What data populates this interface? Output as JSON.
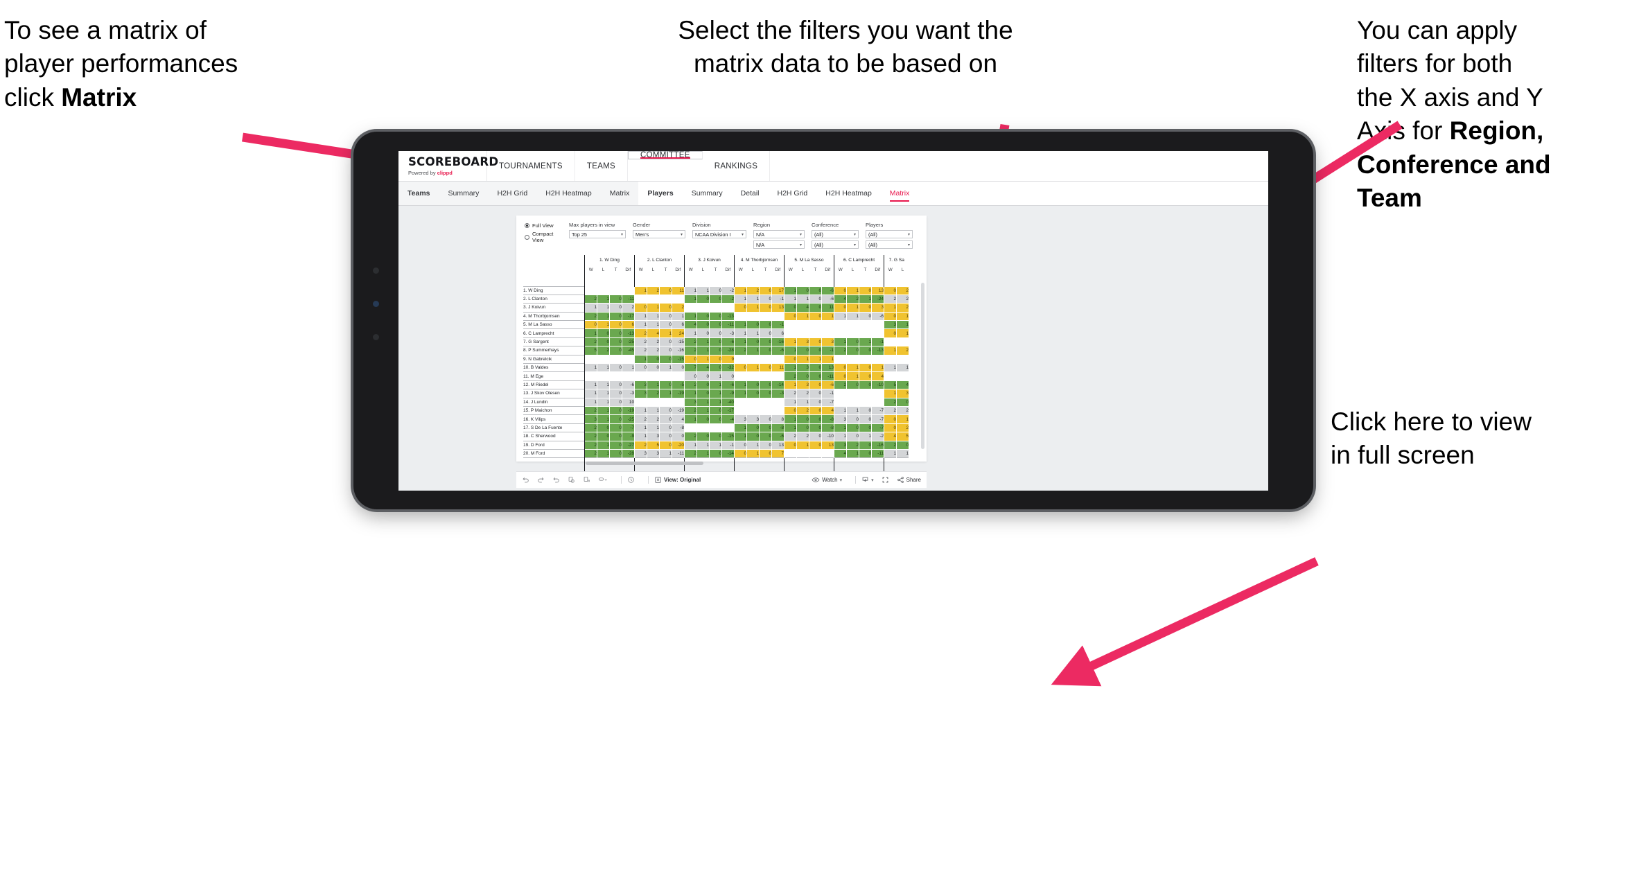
{
  "annotations": {
    "matrix_hint": {
      "pre": "To see a matrix of\nplayer performances\nclick ",
      "bold": "Matrix"
    },
    "filters_hint": "Select the filters you want the\nmatrix data to be based on",
    "axis_hint": {
      "pre": "You  can apply\nfilters for both\nthe X axis and Y\nAxis for ",
      "bold": "Region,\nConference and\nTeam"
    },
    "fullscreen_hint": "Click here to view\nin full screen"
  },
  "accent_color": "#e8174c",
  "brand": {
    "title": "SCOREBOARD",
    "powered_pre": "Powered by ",
    "powered_by": "clippd"
  },
  "main_nav": [
    {
      "label": "TOURNAMENTS",
      "selected": false
    },
    {
      "label": "TEAMS",
      "selected": false
    },
    {
      "label": "COMMITTEE",
      "selected": true
    },
    {
      "label": "RANKINGS",
      "selected": false
    }
  ],
  "sub_nav": {
    "teams_group": [
      {
        "label": "Teams",
        "head": true,
        "active": false
      },
      {
        "label": "Summary",
        "head": false,
        "active": false
      },
      {
        "label": "H2H Grid",
        "head": false,
        "active": false
      },
      {
        "label": "H2H Heatmap",
        "head": false,
        "active": false
      },
      {
        "label": "Matrix",
        "head": false,
        "active": false
      }
    ],
    "players_group": [
      {
        "label": "Players",
        "head": true,
        "active": false
      },
      {
        "label": "Summary",
        "head": false,
        "active": false
      },
      {
        "label": "Detail",
        "head": false,
        "active": false
      },
      {
        "label": "H2H Grid",
        "head": false,
        "active": false
      },
      {
        "label": "H2H Heatmap",
        "head": false,
        "active": false
      },
      {
        "label": "Matrix",
        "head": false,
        "active": true
      }
    ]
  },
  "filters": {
    "view_options": [
      {
        "label": "Full View",
        "selected": true
      },
      {
        "label": "Compact View",
        "selected": false
      }
    ],
    "max_players": {
      "label": "Max players in view",
      "value": "Top 25"
    },
    "gender": {
      "label": "Gender",
      "value": "Men's"
    },
    "division": {
      "label": "Division",
      "value": "NCAA Division I"
    },
    "region": {
      "label": "Region",
      "x_value": "N/A",
      "y_value": "N/A"
    },
    "conference": {
      "label": "Conference",
      "x_value": "(All)",
      "y_value": "(All)"
    },
    "players": {
      "label": "Players",
      "x_value": "(All)",
      "y_value": "(All)"
    }
  },
  "matrix": {
    "sub_headers": [
      "W",
      "L",
      "T",
      "Dif"
    ],
    "columns": [
      "1. W Ding",
      "2. L Clanton",
      "3. J Koivun",
      "4. M Thorbjornsen",
      "5. M La Sasso",
      "6. C Lamprecht",
      "7. G Sa"
    ],
    "rows": [
      {
        "name": "1. W Ding",
        "cells": [
          [
            "w",
            "",
            "",
            "",
            ""
          ],
          [
            "y",
            "1",
            "2",
            "0",
            "11"
          ],
          [
            "s",
            "1",
            "1",
            "0",
            "-2"
          ],
          [
            "y",
            "1",
            "2",
            "0",
            "17"
          ],
          [
            "g",
            "1",
            "0",
            "0",
            "-6"
          ],
          [
            "y",
            "0",
            "1",
            "0",
            "13"
          ],
          [
            "y",
            "0",
            "2"
          ]
        ]
      },
      {
        "name": "2. L Clanton",
        "cells": [
          [
            "g",
            "2",
            "1",
            "0",
            "-11"
          ],
          [
            "w",
            "",
            "",
            "",
            ""
          ],
          [
            "g",
            "1",
            "0",
            "0",
            "-2"
          ],
          [
            "s",
            "1",
            "1",
            "0",
            "-1"
          ],
          [
            "s",
            "1",
            "1",
            "0",
            "-6"
          ],
          [
            "g",
            "4",
            "2",
            "1",
            "-24"
          ],
          [
            "s",
            "2",
            "2"
          ]
        ]
      },
      {
        "name": "3. J Koivun",
        "cells": [
          [
            "s",
            "1",
            "1",
            "0",
            "2"
          ],
          [
            "y",
            "0",
            "1",
            "0",
            "2"
          ],
          [
            "w",
            "",
            "",
            "",
            ""
          ],
          [
            "y",
            "0",
            "1",
            "0",
            "13"
          ],
          [
            "g",
            "0",
            "4",
            "0",
            "11"
          ],
          [
            "y",
            "0",
            "1",
            "0",
            "3"
          ],
          [
            "y",
            "1",
            "2"
          ]
        ]
      },
      {
        "name": "4. M Thorbjornsen",
        "cells": [
          [
            "g",
            "2",
            "1",
            "0",
            "-17"
          ],
          [
            "s",
            "1",
            "1",
            "0",
            "1"
          ],
          [
            "g",
            "1",
            "0",
            "0",
            "-13"
          ],
          [
            "w",
            "",
            "",
            "",
            ""
          ],
          [
            "y",
            "0",
            "1",
            "0",
            "1"
          ],
          [
            "s",
            "1",
            "1",
            "0",
            "-6"
          ],
          [
            "y",
            "0",
            "1"
          ]
        ]
      },
      {
        "name": "5. M La Sasso",
        "cells": [
          [
            "y",
            "0",
            "1",
            "0",
            "6"
          ],
          [
            "s",
            "1",
            "1",
            "0",
            "6"
          ],
          [
            "g",
            "4",
            "0",
            "0",
            "-11"
          ],
          [
            "g",
            "1",
            "0",
            "0",
            "-1"
          ],
          [
            "w",
            "",
            "",
            "",
            ""
          ],
          [
            "w",
            "",
            "",
            "",
            ""
          ],
          [
            "g",
            "3",
            "1"
          ]
        ]
      },
      {
        "name": "6. C Lamprecht",
        "cells": [
          [
            "g",
            "1",
            "0",
            "0",
            "-13"
          ],
          [
            "y",
            "2",
            "4",
            "1",
            "24"
          ],
          [
            "s",
            "1",
            "0",
            "0",
            "-3"
          ],
          [
            "s",
            "1",
            "1",
            "0",
            "6"
          ],
          [
            "w",
            "",
            "",
            "",
            ""
          ],
          [
            "w",
            "",
            "",
            "",
            ""
          ],
          [
            "y",
            "0",
            "1"
          ]
        ]
      },
      {
        "name": "7. G Sargent",
        "cells": [
          [
            "g",
            "2",
            "0",
            "0",
            "-25"
          ],
          [
            "s",
            "2",
            "2",
            "0",
            "-15"
          ],
          [
            "g",
            "2",
            "1",
            "0",
            "-6"
          ],
          [
            "g",
            "1",
            "0",
            "0",
            "-16"
          ],
          [
            "y",
            "1",
            "3",
            "0",
            "3"
          ],
          [
            "g",
            "1",
            "0",
            "1",
            "-1"
          ],
          [
            "w",
            "",
            ""
          ]
        ]
      },
      {
        "name": "8. P Summerhays",
        "cells": [
          [
            "g",
            "5",
            "2",
            "0",
            "-45"
          ],
          [
            "s",
            "2",
            "2",
            "0",
            "-16"
          ],
          [
            "g",
            "2",
            "1",
            "0",
            "-28"
          ],
          [
            "g",
            "2",
            "1",
            "0",
            "-6"
          ],
          [
            "g",
            "1",
            "0",
            "0",
            "-1"
          ],
          [
            "g",
            "2",
            "0",
            "0",
            "-13"
          ],
          [
            "y",
            "1",
            "2"
          ]
        ]
      },
      {
        "name": "9. N Gabrelcik",
        "cells": [
          [
            "w",
            "",
            "",
            "",
            ""
          ],
          [
            "g",
            "1",
            "0",
            "0",
            "-15"
          ],
          [
            "y",
            "0",
            "1",
            "0",
            "9"
          ],
          [
            "w",
            "",
            "",
            "",
            ""
          ],
          [
            "y",
            "0",
            "1",
            "1",
            "1"
          ],
          [
            "w",
            "",
            "",
            "",
            ""
          ],
          [
            "w",
            "",
            ""
          ]
        ]
      },
      {
        "name": "10. B Valdes",
        "cells": [
          [
            "s",
            "1",
            "1",
            "0",
            "1"
          ],
          [
            "s",
            "0",
            "0",
            "1",
            "0"
          ],
          [
            "g",
            "7",
            "4",
            "0",
            "-32"
          ],
          [
            "y",
            "0",
            "1",
            "0",
            "11"
          ],
          [
            "g",
            "1",
            "3",
            "0",
            "13"
          ],
          [
            "y",
            "0",
            "1",
            "0",
            "1"
          ],
          [
            "s",
            "1",
            "1"
          ]
        ]
      },
      {
        "name": "11. M Ege",
        "cells": [
          [
            "w",
            "",
            "",
            "",
            ""
          ],
          [
            "w",
            "",
            "",
            "",
            ""
          ],
          [
            "s",
            "0",
            "0",
            "1",
            "0"
          ],
          [
            "w",
            "",
            "",
            "",
            ""
          ],
          [
            "g",
            "2",
            "0",
            "0",
            "-11"
          ],
          [
            "y",
            "0",
            "1",
            "0",
            "4"
          ],
          [
            "w",
            "",
            ""
          ]
        ]
      },
      {
        "name": "12. M Riedel",
        "cells": [
          [
            "s",
            "1",
            "1",
            "0",
            "-6"
          ],
          [
            "g",
            "3",
            "1",
            "0",
            "-5"
          ],
          [
            "g",
            "2",
            "0",
            "1",
            "-6"
          ],
          [
            "g",
            "1",
            "0",
            "0",
            "-14"
          ],
          [
            "y",
            "1",
            "3",
            "0",
            "-6"
          ],
          [
            "g",
            "2",
            "0",
            "0",
            "-10"
          ],
          [
            "g",
            "5",
            "4"
          ]
        ]
      },
      {
        "name": "13. J Skov Olesen",
        "cells": [
          [
            "s",
            "1",
            "1",
            "0",
            "-3"
          ],
          [
            "g",
            "3",
            "2",
            "1",
            "-19"
          ],
          [
            "g",
            "1",
            "0",
            "1",
            "-9"
          ],
          [
            "g",
            "1",
            "0",
            "0",
            "-3"
          ],
          [
            "s",
            "2",
            "2",
            "0",
            "-1"
          ],
          [
            "w",
            "",
            "",
            "",
            ""
          ],
          [
            "y",
            "1",
            "3"
          ]
        ]
      },
      {
        "name": "14. J Lundin",
        "cells": [
          [
            "s",
            "1",
            "1",
            "0",
            "10"
          ],
          [
            "w",
            "",
            "",
            "",
            ""
          ],
          [
            "g",
            "3",
            "1",
            "1",
            "-40"
          ],
          [
            "w",
            "",
            "",
            "",
            ""
          ],
          [
            "s",
            "1",
            "1",
            "0",
            "-7"
          ],
          [
            "w",
            "",
            "",
            "",
            ""
          ],
          [
            "g",
            "2",
            "0"
          ]
        ]
      },
      {
        "name": "15. P Maichon",
        "cells": [
          [
            "g",
            "2",
            "1",
            "0",
            "-19"
          ],
          [
            "s",
            "1",
            "1",
            "0",
            "-19"
          ],
          [
            "g",
            "2",
            "1",
            "0",
            "-17"
          ],
          [
            "w",
            "",
            "",
            "",
            ""
          ],
          [
            "y",
            "0",
            "2",
            "0",
            "4"
          ],
          [
            "s",
            "1",
            "1",
            "0",
            "-7"
          ],
          [
            "s",
            "2",
            "2"
          ]
        ]
      },
      {
        "name": "16. K Vilips",
        "cells": [
          [
            "g",
            "3",
            "1",
            "0",
            "-25"
          ],
          [
            "s",
            "2",
            "2",
            "0",
            "4"
          ],
          [
            "g",
            "1",
            "0",
            "0",
            "-4"
          ],
          [
            "s",
            "3",
            "3",
            "0",
            "8"
          ],
          [
            "g",
            "1",
            "0",
            "0",
            "-8"
          ],
          [
            "s",
            "3",
            "0",
            "0",
            "-7"
          ],
          [
            "y",
            "0",
            "1"
          ]
        ]
      },
      {
        "name": "17. S De La Fuente",
        "cells": [
          [
            "g",
            "2",
            "0",
            "0",
            "-7"
          ],
          [
            "s",
            "1",
            "1",
            "0",
            "-8"
          ],
          [
            "w",
            "",
            "",
            "",
            ""
          ],
          [
            "g",
            "1",
            "0",
            "0",
            "-8"
          ],
          [
            "g",
            "1",
            "0",
            "0",
            "-8"
          ],
          [
            "g",
            "1",
            "0",
            "0",
            "-7"
          ],
          [
            "y",
            "0",
            "2"
          ]
        ]
      },
      {
        "name": "18. C Sherwood",
        "cells": [
          [
            "g",
            "2",
            "0",
            "0",
            "-9"
          ],
          [
            "s",
            "1",
            "3",
            "0",
            "0"
          ],
          [
            "g",
            "2",
            "0",
            "0",
            "-15"
          ],
          [
            "g",
            "1",
            "0",
            "0",
            "-6"
          ],
          [
            "s",
            "2",
            "2",
            "0",
            "-10"
          ],
          [
            "s",
            "1",
            "0",
            "1",
            "-2"
          ],
          [
            "y",
            "4",
            "5"
          ]
        ]
      },
      {
        "name": "19. D Ford",
        "cells": [
          [
            "g",
            "2",
            "1",
            "0",
            "-27"
          ],
          [
            "y",
            "2",
            "5",
            "0",
            "-20"
          ],
          [
            "s",
            "1",
            "1",
            "1",
            "-1"
          ],
          [
            "s",
            "0",
            "1",
            "0",
            "13"
          ],
          [
            "y",
            "0",
            "1",
            "0",
            "13"
          ],
          [
            "g",
            "3",
            "2",
            "0",
            "-16"
          ],
          [
            "g",
            "2",
            "0"
          ]
        ]
      },
      {
        "name": "20. M Ford",
        "cells": [
          [
            "g",
            "2",
            "1",
            "0",
            "-28"
          ],
          [
            "s",
            "3",
            "3",
            "1",
            "-11"
          ],
          [
            "g",
            "2",
            "1",
            "0",
            "-14"
          ],
          [
            "y",
            "0",
            "1",
            "0",
            "7"
          ],
          [
            "w",
            "",
            "",
            "",
            ""
          ],
          [
            "g",
            "4",
            "1",
            "0",
            "-11"
          ],
          [
            "s",
            "1",
            "1"
          ]
        ]
      }
    ]
  },
  "toolbar": {
    "undo": "undo-icon",
    "redo": "redo-icon",
    "revert": "revert-icon",
    "refresh": "refresh-data-icon",
    "pause": "pause-icon",
    "view_label": "View: Original",
    "watch_label": "Watch",
    "share_label": "Share"
  }
}
